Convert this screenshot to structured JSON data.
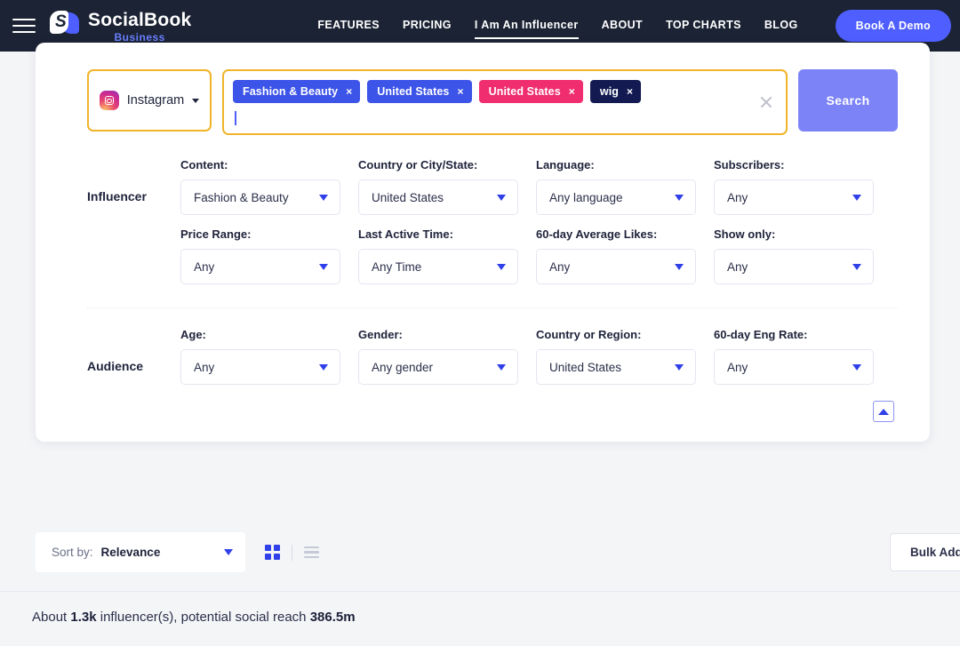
{
  "topnav": {
    "menu_icon": "hamburger-icon",
    "brand": {
      "name": "SocialBook",
      "sub": "Business",
      "logo_letter": "S"
    },
    "links": [
      {
        "label": "FEATURES",
        "active": false
      },
      {
        "label": "PRICING",
        "active": false
      },
      {
        "label": "I Am An Influencer",
        "active": true
      },
      {
        "label": "ABOUT",
        "active": false
      },
      {
        "label": "TOP CHARTS",
        "active": false
      },
      {
        "label": "BLOG",
        "active": false
      }
    ],
    "demo_button": "Book A Demo"
  },
  "search": {
    "platform": {
      "label": "Instagram",
      "icon": "instagram-icon"
    },
    "tags": [
      {
        "label": "Fashion & Beauty",
        "color": "#3d54e8",
        "remove": "×"
      },
      {
        "label": "United States",
        "color": "#3d54e8",
        "remove": "×"
      },
      {
        "label": "United States",
        "color": "#ef2d6f",
        "remove": "×"
      },
      {
        "label": "wig",
        "color": "#131a52",
        "remove": "×"
      }
    ],
    "clear_icon": "clear-icon",
    "input_value": "",
    "search_button": "Search"
  },
  "filters": {
    "influencer_label": "Influencer",
    "audience_label": "Audience",
    "influencer_row1": [
      {
        "label": "Content:",
        "value": "Fashion & Beauty"
      },
      {
        "label": "Country or City/State:",
        "value": "United States"
      },
      {
        "label": "Language:",
        "value": "Any language"
      },
      {
        "label": "Subscribers:",
        "value": "Any"
      }
    ],
    "influencer_row2": [
      {
        "label": "Price Range:",
        "value": "Any"
      },
      {
        "label": "Last Active Time:",
        "value": "Any Time"
      },
      {
        "label": "60-day Average Likes:",
        "value": "Any"
      },
      {
        "label": "Show only:",
        "value": "Any"
      }
    ],
    "audience_row1": [
      {
        "label": "Age:",
        "value": "Any"
      },
      {
        "label": "Gender:",
        "value": "Any gender"
      },
      {
        "label": "Country or Region:",
        "value": "United States"
      },
      {
        "label": "60-day Eng Rate:",
        "value": "Any"
      }
    ],
    "collapse_icon": "chevron-up-icon"
  },
  "results": {
    "sort_label": "Sort by:",
    "sort_value": "Relevance",
    "grid_view_icon": "grid-view-icon",
    "list_view_icon": "list-view-icon",
    "bulk_button": "Bulk Add",
    "about_prefix": "About ",
    "about_count": "1.3k",
    "about_middle": " influencer(s), potential social reach ",
    "about_reach": "386.5m"
  },
  "colors": {
    "nav_bg": "#1b2334",
    "accent_blue": "#4f5fff",
    "highlight_yellow": "#f0b429",
    "search_btn": "#7b83f7",
    "page_bg": "#f4f5f7"
  }
}
